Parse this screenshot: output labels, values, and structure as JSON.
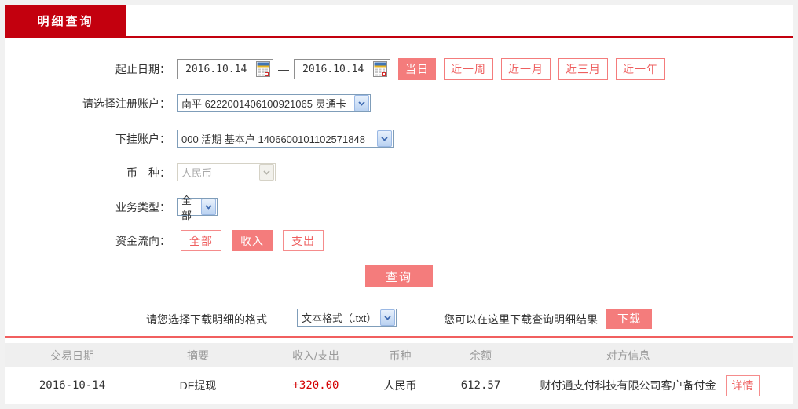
{
  "colors": {
    "brand_red": "#c3000e",
    "salmon": "#f47c7c",
    "separator_red": "#f15f5f",
    "amount_red": "#d40000",
    "page_background": "#f1f1f1"
  },
  "tab": {
    "label": "明细查询"
  },
  "form": {
    "date_range": {
      "label": "起止日期：",
      "start": "2016.10.14",
      "end": "2016.10.14",
      "separator": "—",
      "quick_buttons": [
        {
          "label": "当日",
          "active": true
        },
        {
          "label": "近一周",
          "active": false
        },
        {
          "label": "近一月",
          "active": false
        },
        {
          "label": "近三月",
          "active": false
        },
        {
          "label": "近一年",
          "active": false
        }
      ]
    },
    "register_account": {
      "label": "请选择注册账户：",
      "value": "南平 6222001406100921065 灵通卡"
    },
    "sub_account": {
      "label": "下挂账户：",
      "value": "000 活期 基本户 1406600101102571848"
    },
    "currency": {
      "label": "币　种：",
      "value": "人民币",
      "disabled": true
    },
    "business_type": {
      "label": "业务类型：",
      "value": "全部"
    },
    "fund_flow": {
      "label": "资金流向：",
      "options": [
        {
          "label": "全部",
          "active": false
        },
        {
          "label": "收入",
          "active": true
        },
        {
          "label": "支出",
          "active": false
        }
      ]
    },
    "query_button": "查询"
  },
  "download": {
    "format_label": "请您选择下载明细的格式",
    "format_value": "文本格式（.txt）",
    "hint": "您可以在这里下载查询明细结果",
    "button": "下载"
  },
  "table": {
    "headers": [
      "交易日期",
      "摘要",
      "收入/支出",
      "币种",
      "余额",
      "对方信息"
    ],
    "rows": [
      {
        "date": "2016-10-14",
        "summary": "DF提现",
        "amount": "+320.00",
        "currency": "人民币",
        "balance": "612.57",
        "counterparty": "财付通支付科技有限公司客户备付金",
        "detail_button": "详情"
      }
    ]
  }
}
